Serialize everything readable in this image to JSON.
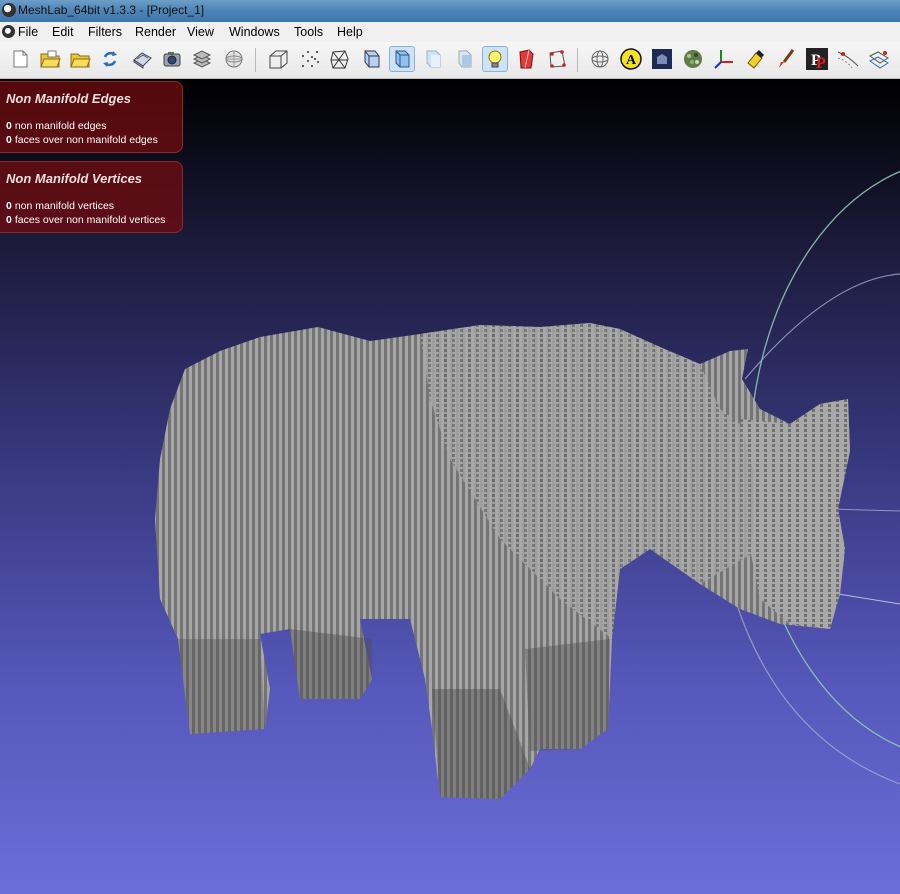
{
  "window": {
    "title": "MeshLab_64bit v1.3.3 - [Project_1]"
  },
  "menu": [
    "File",
    "Edit",
    "Filters",
    "Render",
    "View",
    "Windows",
    "Tools",
    "Help"
  ],
  "toolbar": {
    "icons": [
      "new-file-icon",
      "open-project-icon",
      "open-mesh-icon",
      "reload-icon",
      "export-icon",
      "snapshot-icon",
      "layers-icon",
      "decoration-icon",
      "bounding-box-icon",
      "points-icon",
      "wireframe-icon",
      "hidden-lines-icon",
      "flat-lines-icon",
      "flat-icon",
      "smooth-icon",
      "lighting-icon",
      "double-side-icon",
      "texture-icon",
      "trackball-icon",
      "annotation-icon",
      "shade-icon",
      "color-icon",
      "axis-icon",
      "paint-icon",
      "brush-icon",
      "pick-points-icon",
      "measure-icon",
      "align-icon"
    ],
    "pressed": [
      "flat-icon",
      "lighting-icon"
    ]
  },
  "info_panels": [
    {
      "title": "Non Manifold Edges",
      "rows": [
        {
          "count": "0",
          "text": "non manifold edges"
        },
        {
          "count": "0",
          "text": "faces over non manifold edges"
        }
      ]
    },
    {
      "title": "Non Manifold Vertices",
      "rows": [
        {
          "count": "0",
          "text": "non manifold vertices"
        },
        {
          "count": "0",
          "text": "faces over non manifold vertices"
        }
      ]
    }
  ],
  "colors": {
    "mesh_light": "#a6a6a6",
    "mesh_dark": "#4a4a4a",
    "panel": "#6e0c10"
  }
}
